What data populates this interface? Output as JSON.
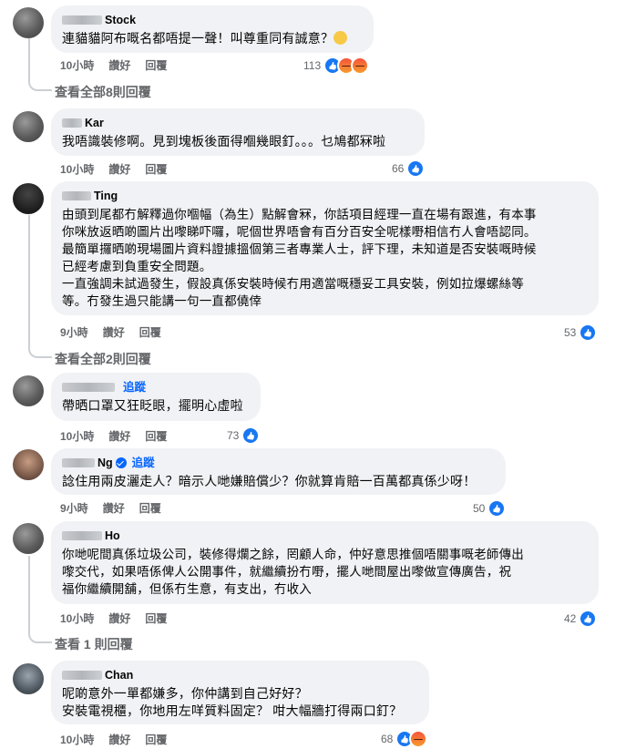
{
  "comments": [
    {
      "name_suffix": "Stock",
      "text": "連貓貓阿布嘅名都唔提一聲！叫尊重同有誠意？",
      "time": "10小時",
      "like_label": "讚好",
      "reply_label": "回覆",
      "reaction_count": "113",
      "reactions": [
        "like-icon",
        "angry-icon",
        "angry-icon"
      ],
      "see_replies": "查看全部8則回覆"
    },
    {
      "name_suffix": "Kar",
      "text": "我唔識裝修啊。見到塊板後面得嗰幾眼釘。。。乜鳩都冧啦",
      "time": "10小時",
      "like_label": "讚好",
      "reply_label": "回覆",
      "reaction_count": "66",
      "reactions": [
        "like-icon"
      ]
    },
    {
      "name_suffix": "Ting",
      "text": "由頭到尾都冇解釋過你嗰幅（為生）點解會冧，你話項目經理一直在場有跟進，有本事\n你咪放返晒啲圖片出嚟睇吓囉，呢個世界唔會有百分百安全呢樣嘢相信冇人會唔認同。\n最簡單攞晒啲現場圖片資料證據搵個第三者專業人士，評下理，未知道是否安裝嘅時候\n已經考慮到負重安全問題。\n一直強調未試過發生，假設真係安裝時候冇用適當嘅穩妥工具安裝，例如拉爆螺絲等\n等。冇發生過只能講一句一直都僥倖",
      "time": "9小時",
      "like_label": "讚好",
      "reply_label": "回覆",
      "reaction_count": "53",
      "reactions": [
        "like-icon"
      ],
      "see_replies": "查看全部2則回覆"
    },
    {
      "follow_label": "追蹤",
      "text": "帶晒口罩又狂眨眼，擺明心虛啦",
      "time": "10小時",
      "like_label": "讚好",
      "reply_label": "回覆",
      "reaction_count": "73",
      "reactions": [
        "like-icon"
      ]
    },
    {
      "name_suffix": "Ng",
      "follow_label": "追蹤",
      "text": "諗住用兩皮灑走人？暗示人哋嫌賠償少？你就算肯賠一百萬都真係少呀！",
      "time": "9小時",
      "like_label": "讚好",
      "reply_label": "回覆",
      "reaction_count": "50",
      "reactions": [
        "like-icon"
      ]
    },
    {
      "name_suffix": "Ho",
      "text": "你哋呢間真係垃圾公司，裝修得爛之餘，罔顧人命，仲好意思推個唔關事嘅老師傳出\n嚟交代，如果唔係俾人公開事件，就繼續扮冇嘢，擺人哋間屋出嚟做宣傳廣告，祝\n福你繼續開舖，但係冇生意，有支出，冇收入",
      "time": "10小時",
      "like_label": "讚好",
      "reply_label": "回覆",
      "reaction_count": "42",
      "reactions": [
        "like-icon"
      ],
      "see_replies": "查看 1 則回覆"
    },
    {
      "name_suffix": "Chan",
      "text": "呢啲意外一單都嫌多，你仲講到自己好好？\n安裝電視櫃，你地用左咩質料固定？ 咁大幅牆打得兩口釘？",
      "time": "10小時",
      "like_label": "讚好",
      "reply_label": "回覆",
      "reaction_count": "68",
      "reactions": [
        "like-icon",
        "angry-icon"
      ]
    }
  ]
}
